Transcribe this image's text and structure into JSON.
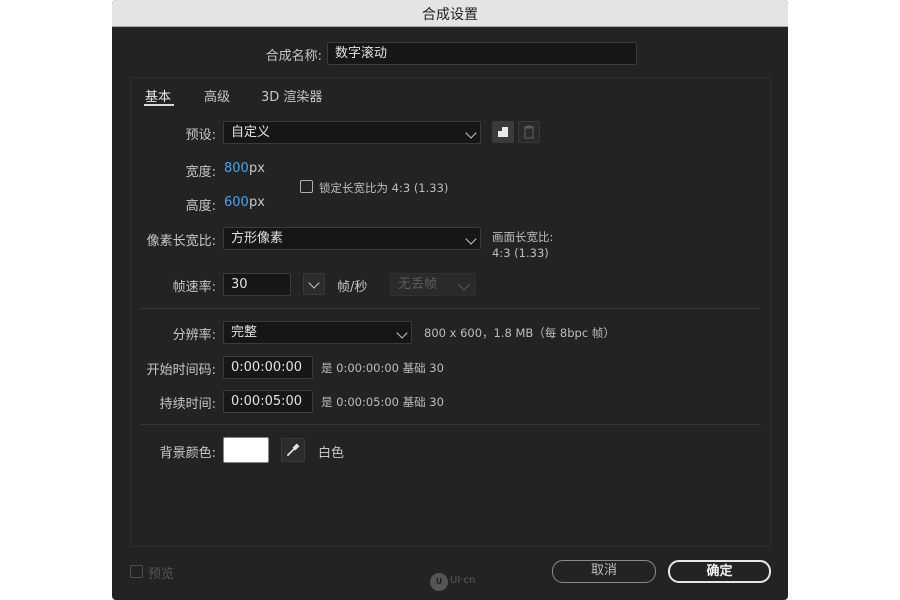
{
  "window": {
    "title": "合成设置"
  },
  "comp_name": {
    "label": "合成名称:",
    "value": "数字滚动"
  },
  "tabs": [
    {
      "label": "基本"
    },
    {
      "label": "高级"
    },
    {
      "label": "3D 渲染器"
    }
  ],
  "preset": {
    "label": "预设:",
    "value": "自定义"
  },
  "width": {
    "label": "宽度:",
    "value": "800",
    "unit": "px"
  },
  "height": {
    "label": "高度:",
    "value": "600",
    "unit": "px"
  },
  "lock_aspect": {
    "label": "锁定长宽比为 4:3 (1.33)",
    "checked": false
  },
  "pixel_aspect": {
    "label": "像素长宽比:",
    "value": "方形像素",
    "frame_aspect_label": "画面长宽比:",
    "frame_aspect_value": "4:3 (1.33)"
  },
  "frame_rate": {
    "label": "帧速率:",
    "value": "30",
    "unit": "帧/秒",
    "drop_frame": "无丢帧"
  },
  "resolution": {
    "label": "分辨率:",
    "value": "完整",
    "info": "800 x 600，1.8 MB（每 8bpc 帧）"
  },
  "start_timecode": {
    "label": "开始时间码:",
    "value": "0:00:00:00",
    "info": "是 0:00:00:00  基础 30"
  },
  "duration": {
    "label": "持续时间:",
    "value": "0:00:05:00",
    "info": "是 0:00:05:00  基础 30"
  },
  "background": {
    "label": "背景颜色:",
    "color": "#ffffff",
    "name": "白色"
  },
  "footer": {
    "preview_label": "预览",
    "preview_checked": false,
    "cancel": "取消",
    "ok": "确定",
    "watermark": "UI·cn"
  },
  "colors": {
    "accent": "#4aa3f0",
    "window_bg": "#232323",
    "title_bg": "#e4e4e4"
  }
}
